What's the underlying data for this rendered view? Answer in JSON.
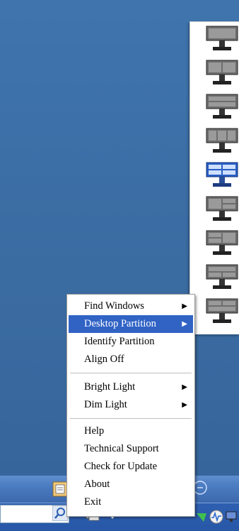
{
  "context_menu": {
    "items": [
      {
        "label": "Find Windows",
        "has_submenu": true
      },
      {
        "label": "Desktop Partition",
        "has_submenu": true,
        "active": true
      },
      {
        "label": "Identify Partition",
        "has_submenu": false
      },
      {
        "label": "Align Off",
        "has_submenu": false
      },
      {
        "label": "Bright Light",
        "has_submenu": true
      },
      {
        "label": "Dim Light",
        "has_submenu": true
      },
      {
        "label": "Help",
        "has_submenu": false
      },
      {
        "label": "Technical Support",
        "has_submenu": false
      },
      {
        "label": "Check for Update",
        "has_submenu": false
      },
      {
        "label": "About",
        "has_submenu": false
      },
      {
        "label": "Exit",
        "has_submenu": false
      }
    ],
    "submenu_arrow": "▶"
  },
  "partition_submenu": {
    "items": [
      {
        "icon": "monitor-full-partition-icon"
      },
      {
        "icon": "monitor-vertical-split-icon"
      },
      {
        "icon": "monitor-horizontal-split-icon"
      },
      {
        "icon": "monitor-three-column-icon"
      },
      {
        "icon": "monitor-quad-partition-icon",
        "selected": true
      },
      {
        "icon": "monitor-left-plus-two-right-icon"
      },
      {
        "icon": "monitor-two-left-plus-right-icon"
      },
      {
        "icon": "monitor-top-plus-two-bottom-icon"
      },
      {
        "icon": "monitor-two-top-plus-bottom-icon"
      }
    ]
  },
  "colors": {
    "menu_highlight": "#3163c5",
    "desktop": "#3b6ea5",
    "taskbar": "#2757a6"
  }
}
